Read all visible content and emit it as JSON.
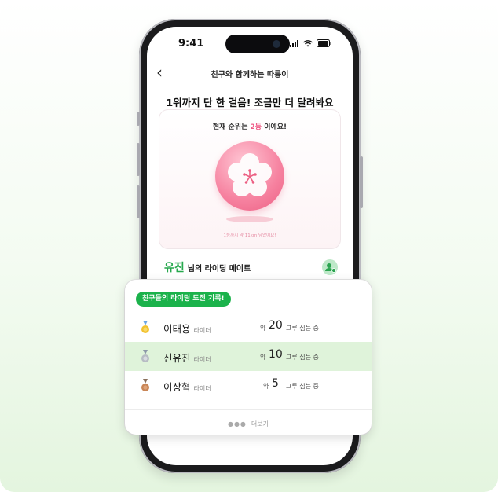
{
  "status_bar": {
    "time": "9:41"
  },
  "nav": {
    "back_glyph": "‹",
    "title": "친구와 함께하는 따릉이"
  },
  "headline": "1위까지 단 한 걸음! 조금만 더 달려봐요",
  "rank_card": {
    "prefix": "현재 순위는",
    "rank": "2등",
    "suffix": "이예요!",
    "footnote": "1등까지 약 11km 남았어요!",
    "medal_icon": "plum-blossom-icon",
    "accent_color": "#ef5b86"
  },
  "mate": {
    "name": "유진",
    "label": "님의 라이딩 메이트",
    "icon": "user-add-icon"
  },
  "sheet": {
    "badge": "친구들의 라이딩 도전 기록!",
    "rows": [
      {
        "medal": "gold-medal-icon",
        "name": "이태용",
        "role": "라이더",
        "approx": "약",
        "count": "20",
        "suffix": "그루 심는 중!"
      },
      {
        "medal": "silver-medal-icon",
        "name": "신유진",
        "role": "라이더",
        "approx": "약",
        "count": "10",
        "suffix": "그루 심는 중!"
      },
      {
        "medal": "bronze-medal-icon",
        "name": "이상혁",
        "role": "라이더",
        "approx": "약",
        "count": "5",
        "suffix": "그루 심는 중!"
      }
    ],
    "more_label": "더보기",
    "accent_color": "#1bb24b"
  }
}
